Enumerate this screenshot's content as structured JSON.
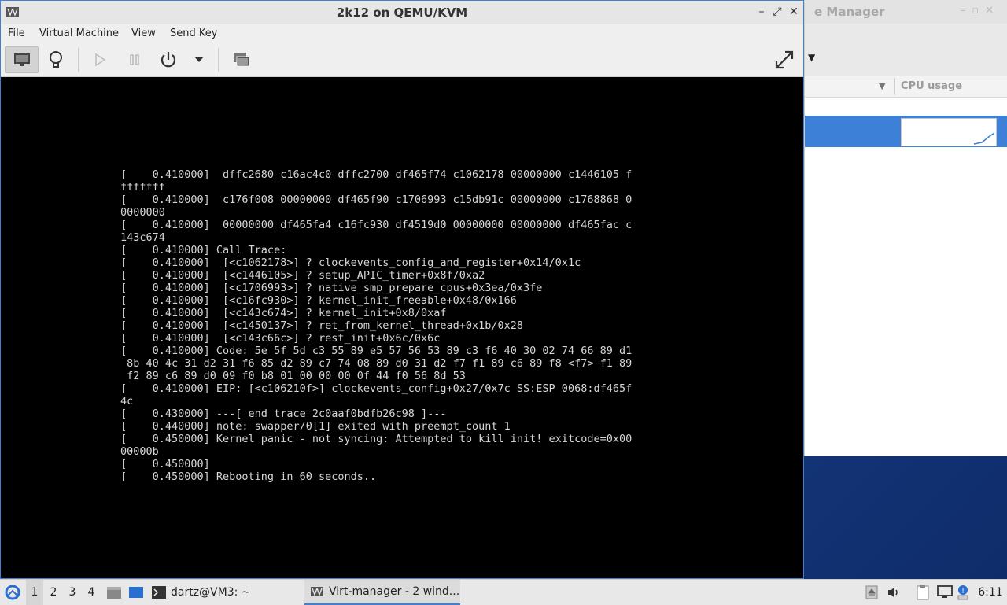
{
  "background_window": {
    "title_fragment": "e Manager",
    "column_header": "CPU usage"
  },
  "vm_window": {
    "title": "2k12 on QEMU/KVM",
    "menu": [
      "File",
      "Virtual Machine",
      "View",
      "Send Key"
    ],
    "console_lines": [
      "[    0.410000]  dffc2680 c16ac4c0 dffc2700 df465f74 c1062178 00000000 c1446105 f",
      "fffffff",
      "[    0.410000]  c176f008 00000000 df465f90 c1706993 c15db91c 00000000 c1768868 0",
      "0000000",
      "[    0.410000]  00000000 df465fa4 c16fc930 df4519d0 00000000 00000000 df465fac c",
      "143c674",
      "[    0.410000] Call Trace:",
      "[    0.410000]  [<c1062178>] ? clockevents_config_and_register+0x14/0x1c",
      "[    0.410000]  [<c1446105>] ? setup_APIC_timer+0x8f/0xa2",
      "[    0.410000]  [<c1706993>] ? native_smp_prepare_cpus+0x3ea/0x3fe",
      "[    0.410000]  [<c16fc930>] ? kernel_init_freeable+0x48/0x166",
      "[    0.410000]  [<c143c674>] ? kernel_init+0x8/0xaf",
      "[    0.410000]  [<c1450137>] ? ret_from_kernel_thread+0x1b/0x28",
      "[    0.410000]  [<c143c66c>] ? rest_init+0x6c/0x6c",
      "[    0.410000] Code: 5e 5f 5d c3 55 89 e5 57 56 53 89 c3 f6 40 30 02 74 66 89 d1",
      " 8b 40 4c 31 d2 31 f6 85 d2 89 c7 74 08 89 d0 31 d2 f7 f1 89 c6 89 f8 <f7> f1 89",
      " f2 89 c6 89 d0 09 f0 b8 01 00 00 00 0f 44 f0 56 8d 53",
      "[    0.410000] EIP: [<c106210f>] clockevents_config+0x27/0x7c SS:ESP 0068:df465f",
      "4c",
      "[    0.430000] ---[ end trace 2c0aaf0bdfb26c98 ]---",
      "[    0.440000] note: swapper/0[1] exited with preempt_count 1",
      "[    0.450000] Kernel panic - not syncing: Attempted to kill init! exitcode=0x00",
      "00000b",
      "[    0.450000]",
      "[    0.450000] Rebooting in 60 seconds.."
    ]
  },
  "taskbar": {
    "workspaces": [
      "1",
      "2",
      "3",
      "4"
    ],
    "terminal_task": "dartz@VM3: ~",
    "virt_manager_task": "Virt-manager - 2 wind...",
    "clock": "6:11"
  }
}
